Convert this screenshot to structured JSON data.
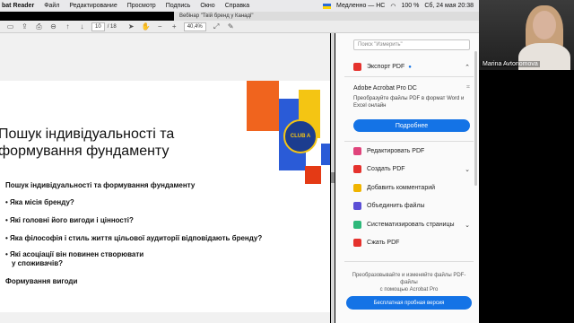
{
  "menubar": {
    "app": "bat Reader",
    "items": [
      "Файл",
      "Редактирование",
      "Просмотр",
      "Подпись",
      "Окно",
      "Справка"
    ],
    "status": "Медленно — НС",
    "battery": "100 %",
    "clock": "Сб, 24 мая 20:38"
  },
  "window": {
    "tab_title": "Вебінар \"Твій бренд у Канаді\""
  },
  "toolbar": {
    "page_current": "10",
    "page_total": "/ 18",
    "zoom": "40,4%"
  },
  "slide": {
    "title_line1": "Пошук індивідуальності та",
    "title_line2": "формування фундаменту",
    "badge_text": "CLUB A",
    "bullets": [
      "Пошук індивідуальності та формування фундаменту",
      "• Яка місія бренду?",
      "• Які головні його вигоди і цінності?",
      "• Яка філософія і стиль життя цільової аудиторії відповідають бренду?",
      "• Які асоціації він повинен створювати",
      "у споживачів?",
      "Формування вигоди"
    ]
  },
  "pane": {
    "search_placeholder": "Поиск \"Измерить\"",
    "export_label": "Экспорт PDF",
    "product_name": "Adobe Acrobat Pro DC",
    "product_desc1": "Преобразуйте файлы PDF в формат Word и",
    "product_desc2": "Excel онлайн",
    "more_button": "Подробнее",
    "tools": [
      "Редактировать PDF",
      "Создать PDF",
      "Добавить комментарий",
      "Объединить файлы",
      "Систематизировать страницы",
      "Сжать PDF"
    ],
    "footer_line1": "Преобразовывайте и изменяйте файлы PDF-файлы",
    "footer_line2": "с помощью Acrobat Pro",
    "trial_button": "Бесплатная пробная версия"
  },
  "video": {
    "participant": "Marina Avtonomova"
  },
  "colors": {
    "accent_blue": "#1473e6",
    "export_red": "#e5322d",
    "slide_orange": "#f0641e",
    "slide_blue": "#2a5bd7",
    "slide_yellow": "#f4c513"
  }
}
